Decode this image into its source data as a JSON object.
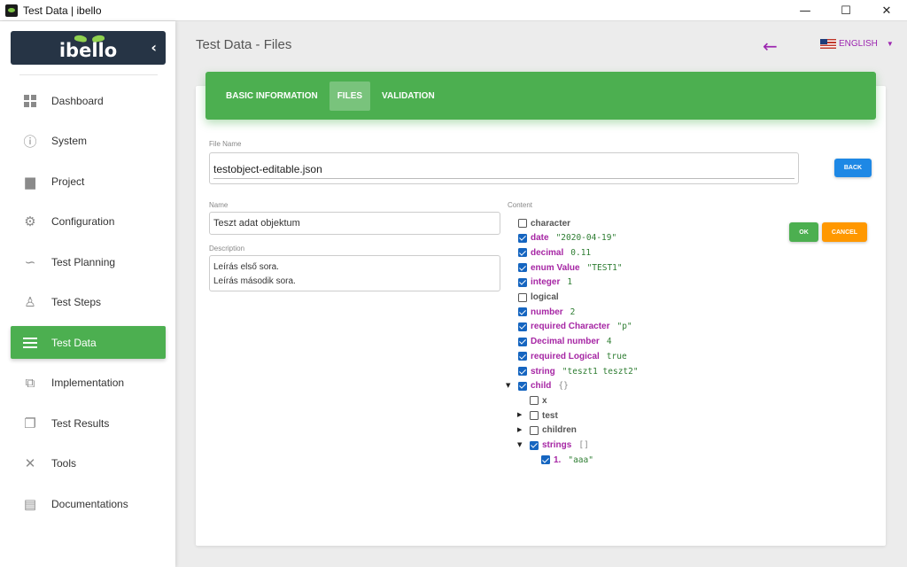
{
  "window": {
    "title": "Test Data | ibello",
    "minimize": "—",
    "maximize": "☐",
    "close": "✕"
  },
  "sidebar": {
    "logo": "ibello",
    "collapse": "‹",
    "items": [
      {
        "label": "Dashboard",
        "icon": "dashboard-icon"
      },
      {
        "label": "System",
        "icon": "info-icon"
      },
      {
        "label": "Project",
        "icon": "briefcase-icon"
      },
      {
        "label": "Configuration",
        "icon": "gear-icon"
      },
      {
        "label": "Test Planning",
        "icon": "route-icon"
      },
      {
        "label": "Test Steps",
        "icon": "walk-icon"
      },
      {
        "label": "Test Data",
        "icon": "list-icon",
        "active": true
      },
      {
        "label": "Implementation",
        "icon": "puzzle-icon"
      },
      {
        "label": "Test Results",
        "icon": "library-icon"
      },
      {
        "label": "Tools",
        "icon": "tools-icon"
      },
      {
        "label": "Documentations",
        "icon": "document-icon"
      }
    ]
  },
  "header": {
    "title": "Test Data - Files",
    "back": "←",
    "language": "ENGLISH",
    "caret": "▼"
  },
  "tabs": [
    {
      "label": "BASIC INFORMATION"
    },
    {
      "label": "FILES",
      "active": true
    },
    {
      "label": "VALIDATION"
    }
  ],
  "form": {
    "file_name_label": "File Name",
    "file_name_value": "testobject-editable.json",
    "back_button": "BACK",
    "name_label": "Name",
    "name_value": "Teszt adat objektum",
    "description_label": "Description",
    "description_line1": "Leírás első sora.",
    "description_line2": "Leírás második sora.",
    "content_label": "Content",
    "ok_button": "OK",
    "cancel_button": "CANCEL"
  },
  "tree": [
    {
      "key": "character",
      "value": "",
      "checked": false,
      "level": 0
    },
    {
      "key": "date",
      "value": "\"2020-04-19\"",
      "checked": true,
      "level": 0
    },
    {
      "key": "decimal",
      "value": "0.11",
      "checked": true,
      "level": 0
    },
    {
      "key": "enum Value",
      "value": "\"TEST1\"",
      "checked": true,
      "level": 0
    },
    {
      "key": "integer",
      "value": "1",
      "checked": true,
      "level": 0
    },
    {
      "key": "logical",
      "value": "",
      "checked": false,
      "level": 0
    },
    {
      "key": "number",
      "value": "2",
      "checked": true,
      "level": 0
    },
    {
      "key": "required Character",
      "value": "\"p\"",
      "checked": true,
      "level": 0
    },
    {
      "key": "Decimal number",
      "value": "4",
      "checked": true,
      "level": 0
    },
    {
      "key": "required Logical",
      "value": "true",
      "checked": true,
      "level": 0
    },
    {
      "key": "string",
      "value": "\"teszt1 teszt2\"",
      "checked": true,
      "level": 0
    },
    {
      "key": "child",
      "value": "{}",
      "checked": true,
      "level": 0,
      "expander": "expanded"
    },
    {
      "key": "x",
      "value": "",
      "checked": false,
      "level": 1
    },
    {
      "key": "test",
      "value": "",
      "checked": false,
      "level": 1,
      "expander": "collapsed"
    },
    {
      "key": "children",
      "value": "",
      "checked": false,
      "level": 1,
      "expander": "collapsed"
    },
    {
      "key": "strings",
      "value": "[]",
      "checked": true,
      "level": 1,
      "expander": "expanded"
    },
    {
      "key": "1.",
      "value": "\"aaa\"",
      "checked": true,
      "level": 2
    }
  ]
}
